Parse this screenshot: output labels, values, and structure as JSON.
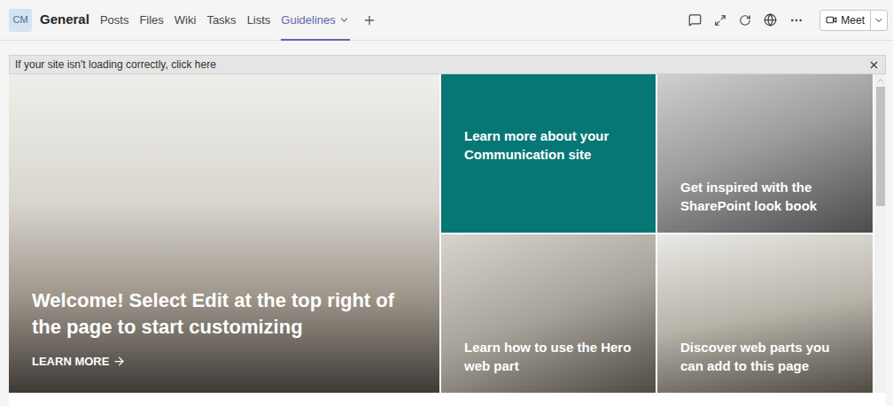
{
  "team": {
    "avatar": "CM",
    "channel": "General"
  },
  "tabs": [
    {
      "label": "Posts",
      "selected": false
    },
    {
      "label": "Files",
      "selected": false
    },
    {
      "label": "Wiki",
      "selected": false
    },
    {
      "label": "Tasks",
      "selected": false
    },
    {
      "label": "Lists",
      "selected": false
    },
    {
      "label": "Guidelines",
      "selected": true
    }
  ],
  "meet_button": {
    "label": "Meet"
  },
  "notice": {
    "text": "If your site isn't loading correctly, click here"
  },
  "hero": [
    {
      "kind": "photo",
      "title": "Welcome! Select Edit at the top right of the page to start customizing",
      "link": "LEARN MORE"
    },
    {
      "kind": "color",
      "title": "Learn more about your Communication site"
    },
    {
      "kind": "photo",
      "title": "Get inspired with the SharePoint look book"
    },
    {
      "kind": "photo",
      "title": "Learn how to use the Hero web part"
    },
    {
      "kind": "photo",
      "title": "Discover web parts you can add to this page"
    }
  ]
}
